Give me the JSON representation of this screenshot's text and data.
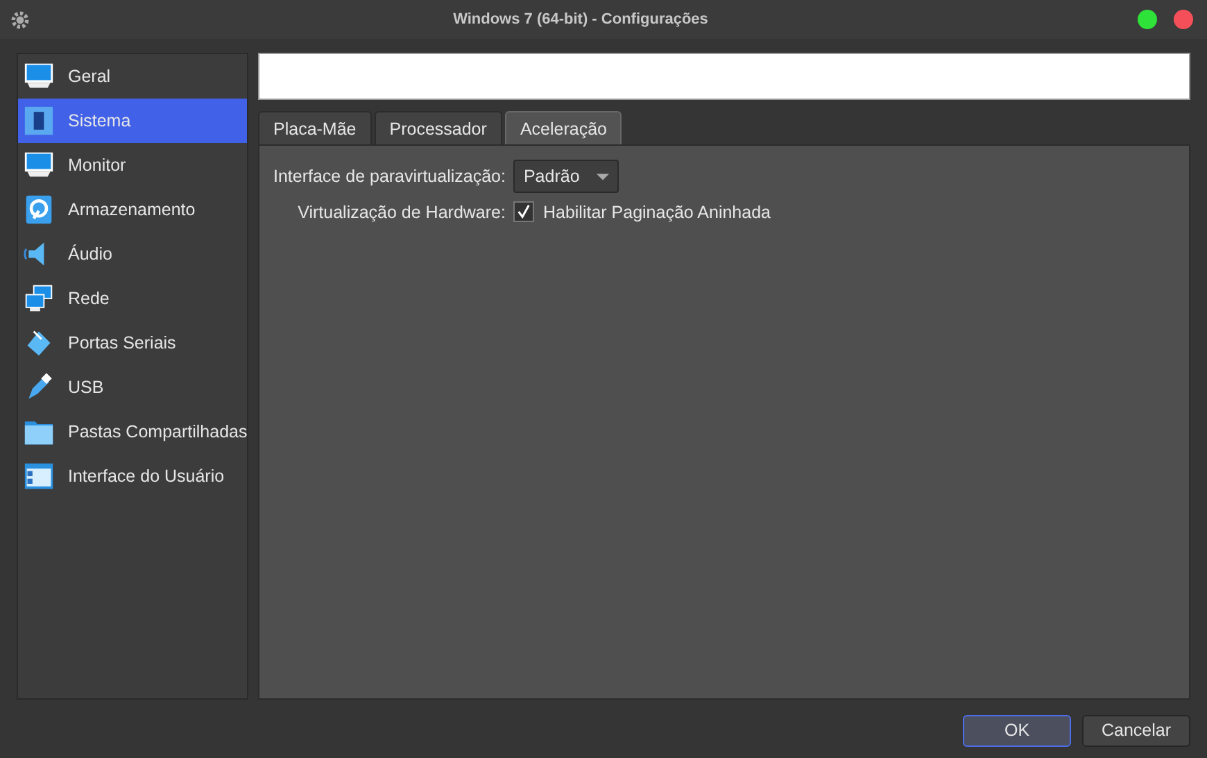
{
  "window": {
    "title": "Windows 7 (64-bit) - Configurações"
  },
  "sidebar": {
    "items": [
      {
        "label": "Geral",
        "selected": false
      },
      {
        "label": "Sistema",
        "selected": true
      },
      {
        "label": "Monitor",
        "selected": false
      },
      {
        "label": "Armazenamento",
        "selected": false
      },
      {
        "label": "Áudio",
        "selected": false
      },
      {
        "label": "Rede",
        "selected": false
      },
      {
        "label": "Portas Seriais",
        "selected": false
      },
      {
        "label": "USB",
        "selected": false
      },
      {
        "label": "Pastas Compartilhadas",
        "selected": false
      },
      {
        "label": "Interface do Usuário",
        "selected": false
      }
    ]
  },
  "tabs": [
    {
      "label": "Placa-Mãe",
      "selected": false
    },
    {
      "label": "Processador",
      "selected": false
    },
    {
      "label": "Aceleração",
      "selected": true
    }
  ],
  "form": {
    "paravirt_label": "Interface de paravirtualização:",
    "paravirt_value": "Padrão",
    "hw_label": "Virtualização de Hardware:",
    "nested_paging": {
      "label": "Habilitar Paginação Aninhada",
      "checked": true
    }
  },
  "buttons": [
    "OK",
    "Cancelar"
  ]
}
